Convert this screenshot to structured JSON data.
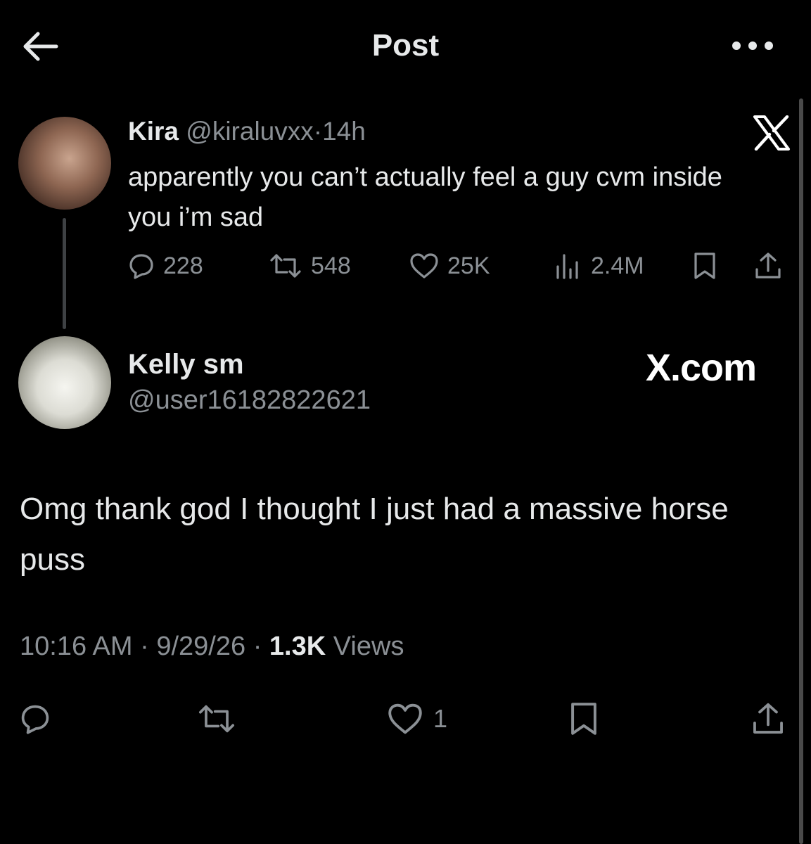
{
  "header": {
    "title": "Post"
  },
  "icons": {
    "back": "arrow-left-icon",
    "more": "more-horizontal-icon",
    "x_logo": "x-logo-icon"
  },
  "parent": {
    "name": "Kira",
    "handle": "@kiraluvxx",
    "separator": "·",
    "time": "14h",
    "text": "apparently you can’t actually feel a guy cvm inside you i’m sad",
    "replies": "228",
    "reposts": "548",
    "likes": "25K",
    "views": "2.4M"
  },
  "reply": {
    "name": "Kelly sm",
    "handle": "@user16182822621",
    "watermark": "X.com",
    "text": "Omg thank god I thought I just had a massive horse puss",
    "time": "10:16 AM",
    "date": "9/29/26",
    "separator": "·",
    "views_count": "1.3K",
    "views_label": "Views",
    "likes": "1"
  },
  "colors": {
    "background": "#000000",
    "text": "#e7e9ea",
    "muted": "#8b9095"
  }
}
